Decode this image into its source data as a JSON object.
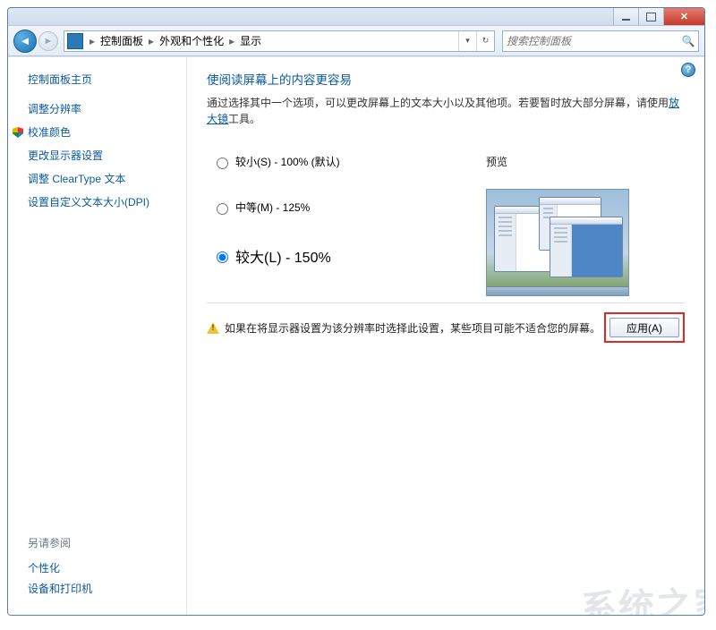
{
  "breadcrumb": {
    "root_symbol": "▸",
    "control_panel": "控制面板",
    "appearance": "外观和个性化",
    "display": "显示"
  },
  "search": {
    "placeholder": "搜索控制面板"
  },
  "sidebar": {
    "home": "控制面板主页",
    "links": [
      {
        "label": "调整分辨率",
        "icon": ""
      },
      {
        "label": "校准颜色",
        "icon": "shield"
      },
      {
        "label": "更改显示器设置",
        "icon": ""
      },
      {
        "label": "调整 ClearType 文本",
        "icon": ""
      },
      {
        "label": "设置自定义文本大小(DPI)",
        "icon": ""
      }
    ],
    "see_also_title": "另请参阅",
    "see_also": [
      "个性化",
      "设备和打印机"
    ]
  },
  "main": {
    "heading": "使阅读屏幕上的内容更容易",
    "desc_before_link": "通过选择其中一个选项，可以更改屏幕上的文本大小以及其他项。若要暂时放大部分屏幕，请使用",
    "desc_link": "放大镜",
    "desc_after_link": "工具。",
    "options": [
      {
        "label": "较小(S) - 100% (默认)",
        "checked": false,
        "big": false
      },
      {
        "label": "中等(M) - 125%",
        "checked": false,
        "big": false
      },
      {
        "label": "较大(L) - 150%",
        "checked": true,
        "big": true
      }
    ],
    "preview_title": "预览",
    "warning": "如果在将显示器设置为该分辨率时选择此设置，某些项目可能不适合您的屏幕。",
    "apply": "应用(A)"
  }
}
